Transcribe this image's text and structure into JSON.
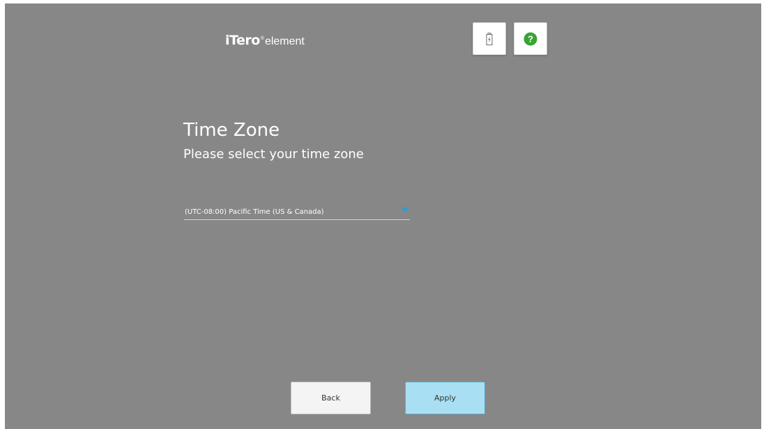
{
  "header": {
    "logo_brand": "iTero",
    "logo_sub": "element",
    "battery_icon": "battery-charging-icon",
    "help_icon": "help-icon",
    "colors": {
      "help": "#3aa335",
      "accent": "#a9dff2",
      "arrow": "#2e9bd6"
    }
  },
  "main": {
    "title": "Time Zone",
    "subtitle": "Please select your time zone",
    "timezone_select": {
      "value": "(UTC-08:00) Pacific Time (US & Canada)"
    }
  },
  "footer": {
    "back_label": "Back",
    "apply_label": "Apply"
  }
}
